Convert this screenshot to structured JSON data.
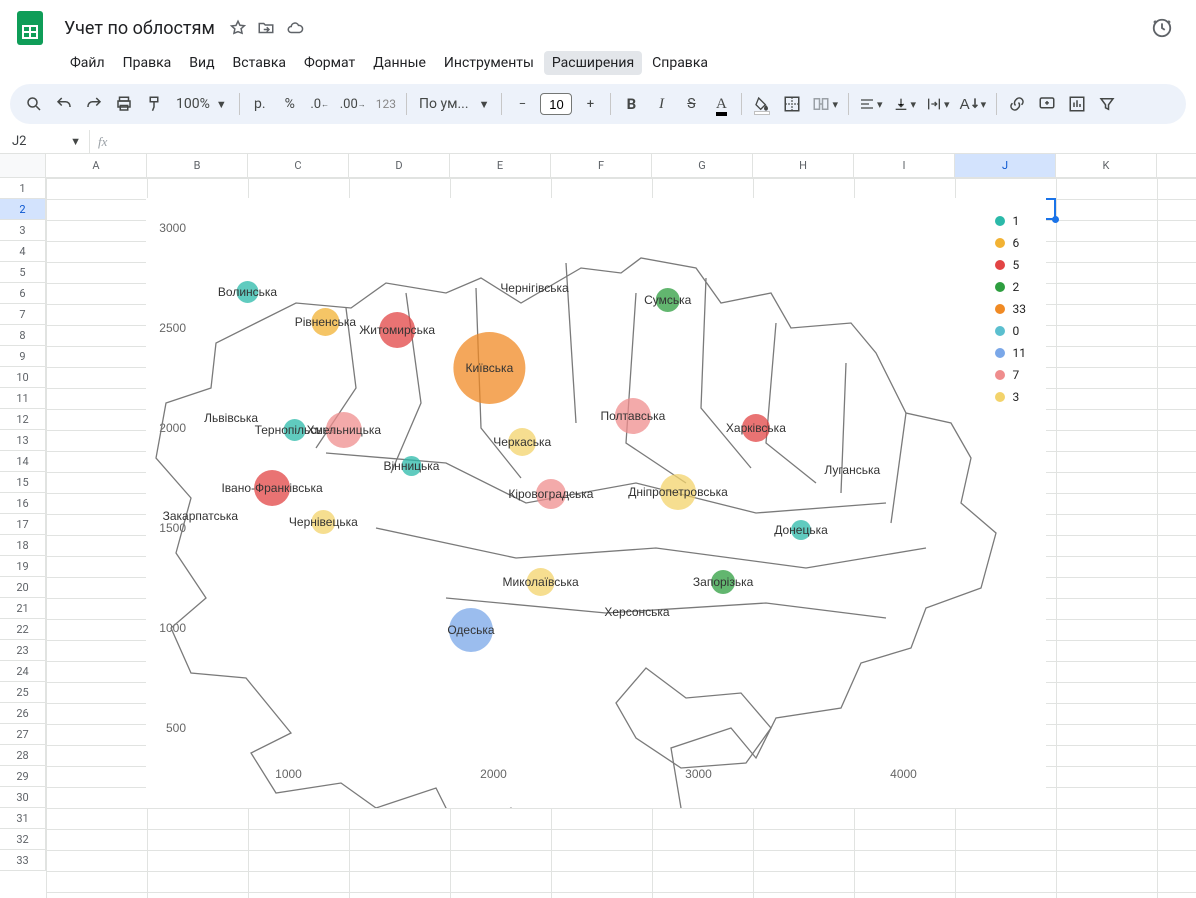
{
  "doc": {
    "title": "Учет по облостям"
  },
  "menus": [
    "Файл",
    "Правка",
    "Вид",
    "Вставка",
    "Формат",
    "Данные",
    "Инструменты",
    "Расширения",
    "Справка"
  ],
  "menu_active_index": 7,
  "toolbar": {
    "zoom": "100%",
    "currency": "р.",
    "percent": "%",
    "digits": "123",
    "font": "По ум...",
    "font_size": "10"
  },
  "name_box": "J2",
  "columns": [
    "A",
    "B",
    "C",
    "D",
    "E",
    "F",
    "G",
    "H",
    "I",
    "J",
    "K"
  ],
  "selected_col_index": 9,
  "rows": 33,
  "selected_row_index": 2,
  "selected_cell": {
    "col": 9,
    "row": 2
  },
  "chart_data": {
    "type": "scatter",
    "x_axis": {
      "ticks": [
        1000,
        2000,
        3000,
        4000
      ]
    },
    "y_axis": {
      "ticks": [
        500,
        1000,
        1500,
        2000,
        2500,
        3000
      ]
    },
    "legend": [
      {
        "value": "1",
        "color": "#2bb9a9"
      },
      {
        "value": "6",
        "color": "#f2b233"
      },
      {
        "value": "5",
        "color": "#e24444"
      },
      {
        "value": "2",
        "color": "#2e9e3f"
      },
      {
        "value": "33",
        "color": "#f08a24"
      },
      {
        "value": "0",
        "color": "#5bbfcf"
      },
      {
        "value": "11",
        "color": "#7aa7e8"
      },
      {
        "value": "7",
        "color": "#ef8d8d"
      },
      {
        "value": "3",
        "color": "#f3d36b"
      }
    ],
    "regions": [
      {
        "name": "Волинська",
        "x": 800,
        "y": 2680,
        "series": "1",
        "r": 11
      },
      {
        "name": "Рівненська",
        "x": 1180,
        "y": 2530,
        "series": "6",
        "r": 14
      },
      {
        "name": "Житомирська",
        "x": 1530,
        "y": 2490,
        "series": "5",
        "r": 18
      },
      {
        "name": "Чернігівська",
        "x": 2200,
        "y": 2700,
        "series": null,
        "r": 0
      },
      {
        "name": "Сумська",
        "x": 2850,
        "y": 2640,
        "series": "2",
        "r": 12
      },
      {
        "name": "Львівська",
        "x": 720,
        "y": 2050,
        "series": null,
        "r": 0
      },
      {
        "name": "Тернопільська",
        "x": 1030,
        "y": 1990,
        "series": "1",
        "r": 11
      },
      {
        "name": "Хмельницька",
        "x": 1270,
        "y": 1990,
        "series": "7",
        "r": 18
      },
      {
        "name": "Київська",
        "x": 1980,
        "y": 2300,
        "series": "33",
        "r": 36
      },
      {
        "name": "Полтавська",
        "x": 2680,
        "y": 2060,
        "series": "7",
        "r": 18
      },
      {
        "name": "Харківська",
        "x": 3280,
        "y": 2000,
        "series": "5",
        "r": 14
      },
      {
        "name": "Вінницька",
        "x": 1600,
        "y": 1810,
        "series": "1",
        "r": 10
      },
      {
        "name": "Черкаська",
        "x": 2140,
        "y": 1930,
        "series": "3",
        "r": 14
      },
      {
        "name": "Івано-Франківська",
        "x": 920,
        "y": 1700,
        "series": "5",
        "r": 18
      },
      {
        "name": "Закарпатська",
        "x": 570,
        "y": 1560,
        "series": null,
        "r": 0
      },
      {
        "name": "Чернівецька",
        "x": 1170,
        "y": 1530,
        "series": "3",
        "r": 12
      },
      {
        "name": "Кіровоградська",
        "x": 2280,
        "y": 1670,
        "series": "7",
        "r": 15
      },
      {
        "name": "Дніпропетровська",
        "x": 2900,
        "y": 1680,
        "series": "3",
        "r": 18
      },
      {
        "name": "Луганська",
        "x": 3750,
        "y": 1790,
        "series": null,
        "r": 0
      },
      {
        "name": "Донецька",
        "x": 3500,
        "y": 1490,
        "series": "1",
        "r": 10
      },
      {
        "name": "Миколаївська",
        "x": 2230,
        "y": 1230,
        "series": "3",
        "r": 14
      },
      {
        "name": "Запорізька",
        "x": 3120,
        "y": 1230,
        "series": "2",
        "r": 12
      },
      {
        "name": "Херсонська",
        "x": 2700,
        "y": 1080,
        "series": null,
        "r": 0
      },
      {
        "name": "Одеська",
        "x": 1890,
        "y": 990,
        "series": "11",
        "r": 22
      }
    ]
  }
}
